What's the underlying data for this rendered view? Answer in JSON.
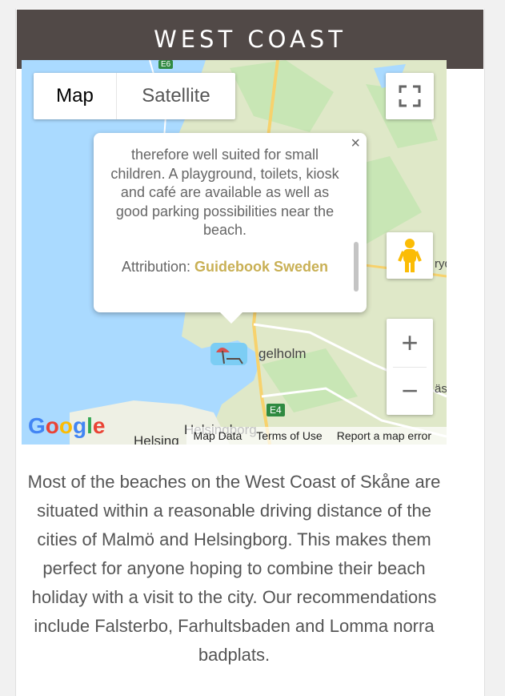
{
  "page": {
    "title": "WEST COAST"
  },
  "map": {
    "type_control": {
      "map_label": "Map",
      "satellite_label": "Satellite",
      "selected": "Map"
    },
    "labels": {
      "city_1": "Helsingborg",
      "city_2": "Helsing",
      "town_partial": "gelholm",
      "road_shield": "E4",
      "edge_fragment_1": "ryd",
      "edge_fragment_2": "äs",
      "top_shield": "E6"
    },
    "infowindow": {
      "text": "therefore well suited for small children. A playground, toilets, kiosk and café are available as well as good parking possibilities near the beach.",
      "attribution_label": "Attribution:",
      "attribution_link": "Guidebook Sweden",
      "close_symbol": "×"
    },
    "zoom_in": "+",
    "zoom_out": "−",
    "logo": {
      "letters": [
        "G",
        "o",
        "o",
        "g",
        "l",
        "e"
      ],
      "colors": [
        "#4285F4",
        "#EA4335",
        "#FBBC05",
        "#4285F4",
        "#34A853",
        "#EA4335"
      ]
    },
    "footer_links": [
      "Map Data",
      "Terms of Use",
      "Report a map error"
    ],
    "icons": {
      "fullscreen": "fullscreen-icon",
      "pegman": "pegman-icon",
      "marker": "beach-umbrella-icon"
    }
  },
  "description": "Most of the beaches on the West Coast of Skåne are situated within a reasonable driving distance of the cities of Malmö and Helsingborg. This makes them perfect for anyone hoping to combine their beach holiday with a visit to the city. Our recommendations include Falsterbo, Farhultsbaden and Lomma norra badplats.",
  "colors": {
    "header_bg": "#514947",
    "accent_link": "#c9b055",
    "water": "#aadaff",
    "land": "#dfe8c8"
  }
}
